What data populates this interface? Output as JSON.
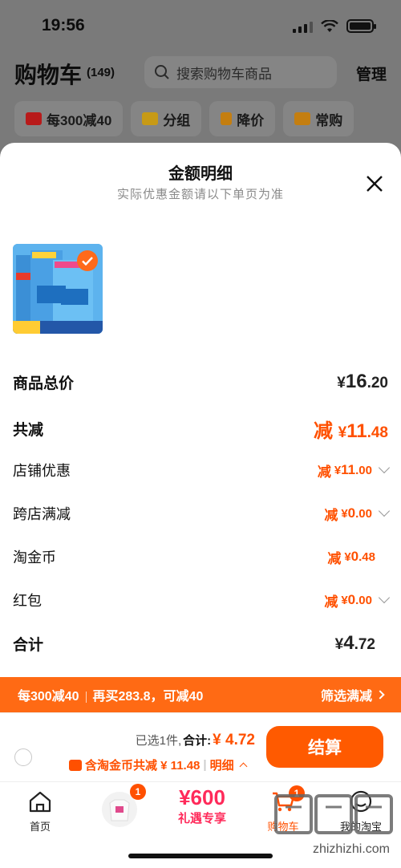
{
  "status_bar": {
    "time": "19:56"
  },
  "header": {
    "title": "购物车",
    "count": "(149)",
    "search_placeholder": "搜索购物车商品",
    "manage_label": "管理"
  },
  "chips": [
    {
      "label": "每300减40",
      "icon": "coupon-icon",
      "color": "#b81a1a"
    },
    {
      "label": "分组",
      "icon": "folder-icon",
      "color": "#c79a16"
    },
    {
      "label": "降价",
      "icon": "price-down-icon",
      "color": "#c47e10"
    },
    {
      "label": "常购",
      "icon": "cart-icon",
      "color": "#c47e10"
    }
  ],
  "sheet": {
    "title": "金额明细",
    "subtitle": "实际优惠金额请以下单页为准",
    "rows": {
      "subtotal": {
        "label": "商品总价",
        "yen": "¥",
        "int": "16",
        "dec": ".20"
      },
      "discount_total": {
        "label": "共减",
        "prefix": "减",
        "yen": "¥",
        "int": "11",
        "dec": ".48"
      },
      "shop_discount": {
        "label": "店铺优惠",
        "prefix": "减",
        "yen": "¥",
        "int": "11",
        "dec": ".00"
      },
      "cross_shop": {
        "label": "跨店满减",
        "prefix": "减",
        "yen": "¥",
        "int": "0",
        "dec": ".00"
      },
      "taojinbi": {
        "label": "淘金币",
        "prefix": "减",
        "yen": "¥",
        "int": "0",
        "dec": ".48"
      },
      "hongbao": {
        "label": "红包",
        "prefix": "减",
        "yen": "¥",
        "int": "0",
        "dec": ".00"
      },
      "total": {
        "label": "合计",
        "yen": "¥",
        "int": "4",
        "dec": ".72"
      }
    }
  },
  "promo_bar": {
    "left_a": "每300减40",
    "left_b": "再买283.8，可减40",
    "right": "筛选满减"
  },
  "checkout": {
    "selected": "已选1件,",
    "total_label": "合计:",
    "total_value": "¥ 4.72",
    "coin_note": "含淘金币共减 ¥ 11.48",
    "detail_label": "明细",
    "pay_label": "结算"
  },
  "tabbar": {
    "home": "首页",
    "promo_num": "¥600",
    "promo_txt": "礼遇专享",
    "cart": "购物车",
    "mine": "我的淘宝",
    "badge_promo": "1",
    "badge_cart": "1"
  },
  "watermark": "zhizhizhi.com",
  "colors": {
    "accent": "#ff5000",
    "promo_bar": "#ff6a14",
    "pay": "#ff5a00"
  }
}
